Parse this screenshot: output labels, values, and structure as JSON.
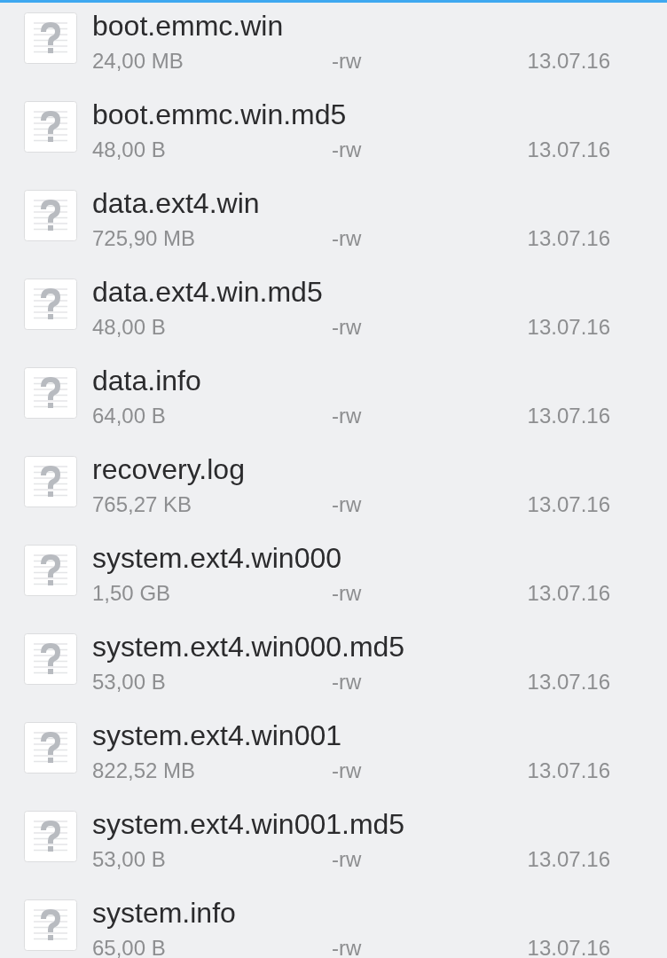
{
  "files": [
    {
      "name": "boot.emmc.win",
      "size": "24,00 MB",
      "permissions": "-rw",
      "date": "13.07.16"
    },
    {
      "name": "boot.emmc.win.md5",
      "size": "48,00 B",
      "permissions": "-rw",
      "date": "13.07.16"
    },
    {
      "name": "data.ext4.win",
      "size": "725,90 MB",
      "permissions": "-rw",
      "date": "13.07.16"
    },
    {
      "name": "data.ext4.win.md5",
      "size": "48,00 B",
      "permissions": "-rw",
      "date": "13.07.16"
    },
    {
      "name": "data.info",
      "size": "64,00 B",
      "permissions": "-rw",
      "date": "13.07.16"
    },
    {
      "name": "recovery.log",
      "size": "765,27 KB",
      "permissions": "-rw",
      "date": "13.07.16"
    },
    {
      "name": "system.ext4.win000",
      "size": "1,50 GB",
      "permissions": "-rw",
      "date": "13.07.16"
    },
    {
      "name": "system.ext4.win000.md5",
      "size": "53,00 B",
      "permissions": "-rw",
      "date": "13.07.16"
    },
    {
      "name": "system.ext4.win001",
      "size": "822,52 MB",
      "permissions": "-rw",
      "date": "13.07.16"
    },
    {
      "name": "system.ext4.win001.md5",
      "size": "53,00 B",
      "permissions": "-rw",
      "date": "13.07.16"
    },
    {
      "name": "system.info",
      "size": "65,00 B",
      "permissions": "-rw",
      "date": "13.07.16"
    }
  ]
}
